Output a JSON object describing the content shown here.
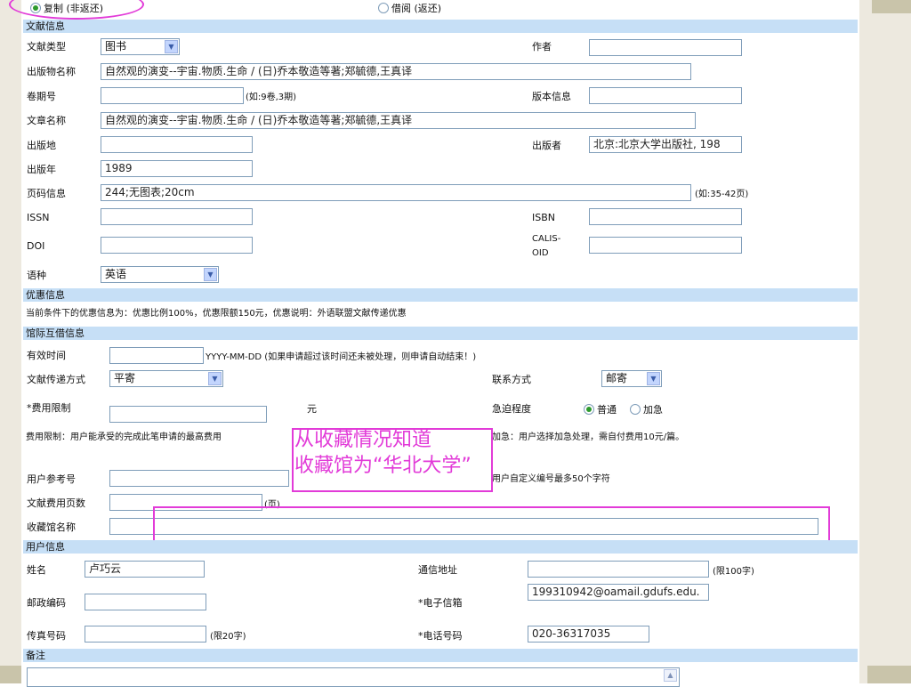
{
  "top_radios": {
    "copy_label": "复制 (非返还)",
    "borrow_label": "借阅 (返还)",
    "selected": "copy"
  },
  "doc": {
    "header": "文献信息",
    "type_label": "文献类型",
    "type_value": "图书",
    "author_label": "作者",
    "author_value": "",
    "pub_name_label": "出版物名称",
    "pub_name_value": "自然观的演变--宇宙.物质.生命 / (日)乔本敬造等著;郑毓德,王真译",
    "volume_label": "卷期号",
    "volume_value": "",
    "volume_hint": "(如:9卷,3期)",
    "edition_label": "版本信息",
    "edition_value": "",
    "article_label": "文章名称",
    "article_value": "自然观的演变--宇宙.物质.生命 / (日)乔本敬造等著;郑毓德,王真译",
    "place_label": "出版地",
    "place_value": "",
    "publisher_label": "出版者",
    "publisher_value": "北京:北京大学出版社, 198",
    "year_label": "出版年",
    "year_value": "1989",
    "pages_label": "页码信息",
    "pages_value": "244;无图表;20cm",
    "pages_hint": "(如:35-42页)",
    "issn_label": "ISSN",
    "issn_value": "",
    "isbn_label": "ISBN",
    "isbn_value": "",
    "doi_label": "DOI",
    "doi_value": "",
    "calis_label_1": "CALIS-",
    "calis_label_2": "OID",
    "calis_value": "",
    "lang_label": "语种",
    "lang_value": "英语"
  },
  "discount": {
    "header": "优惠信息",
    "text": "当前条件下的优惠信息为：优惠比例100%，优惠限额150元，优惠说明：外语联盟文献传递优惠"
  },
  "ill": {
    "header": "馆际互借信息",
    "valid_label": "有效时间",
    "valid_value": "",
    "valid_hint": "YYYY-MM-DD (如果申请超过该时间还未被处理，则申请自动结束！)",
    "delivery_label": "文献传递方式",
    "delivery_value": "平寄",
    "contact_label": "联系方式",
    "contact_value": "邮寄",
    "fee_label": "*费用限制",
    "fee_value": "",
    "fee_unit": "元",
    "urgency_label": "急迫程度",
    "urgency_normal": "普通",
    "urgency_rush": "加急",
    "urgency_selected": "normal",
    "fee_note": "费用限制：用户能承受的完成此笔申请的最高费用",
    "rush_note": "加急：用户选择加急处理，需自付费用10元/篇。",
    "ref_label": "用户参考号",
    "ref_value": "",
    "ref_hint": "用户自定义编号最多50个字符",
    "pages_label": "文献费用页数",
    "pages_value": "",
    "pages_unit": "(页)",
    "library_label": "收藏馆名称",
    "library_value": ""
  },
  "annotation": {
    "line1": "从收藏情况知道",
    "line2": "收藏馆为“华北大学”",
    "color": "#e23bd8"
  },
  "user": {
    "header": "用户信息",
    "name_label": "姓名",
    "name_value": "卢巧云",
    "address_label": "通信地址",
    "address_value": "",
    "address_hint": "(限100字)",
    "zip_label": "邮政编码",
    "zip_value": "",
    "email_label": "*电子信箱",
    "email_value": "199310942@oamail.gdufs.edu.",
    "fax_label": "传真号码",
    "fax_value": "",
    "fax_hint": "(限20字)",
    "phone_label": "*电话号码",
    "phone_value": "020-36317035"
  },
  "remarks": {
    "header": "备注",
    "value": ""
  },
  "colors": {
    "section_header_bg": "#c6dff6",
    "input_border": "#7f9db9",
    "side_panel": "#ede9df"
  }
}
